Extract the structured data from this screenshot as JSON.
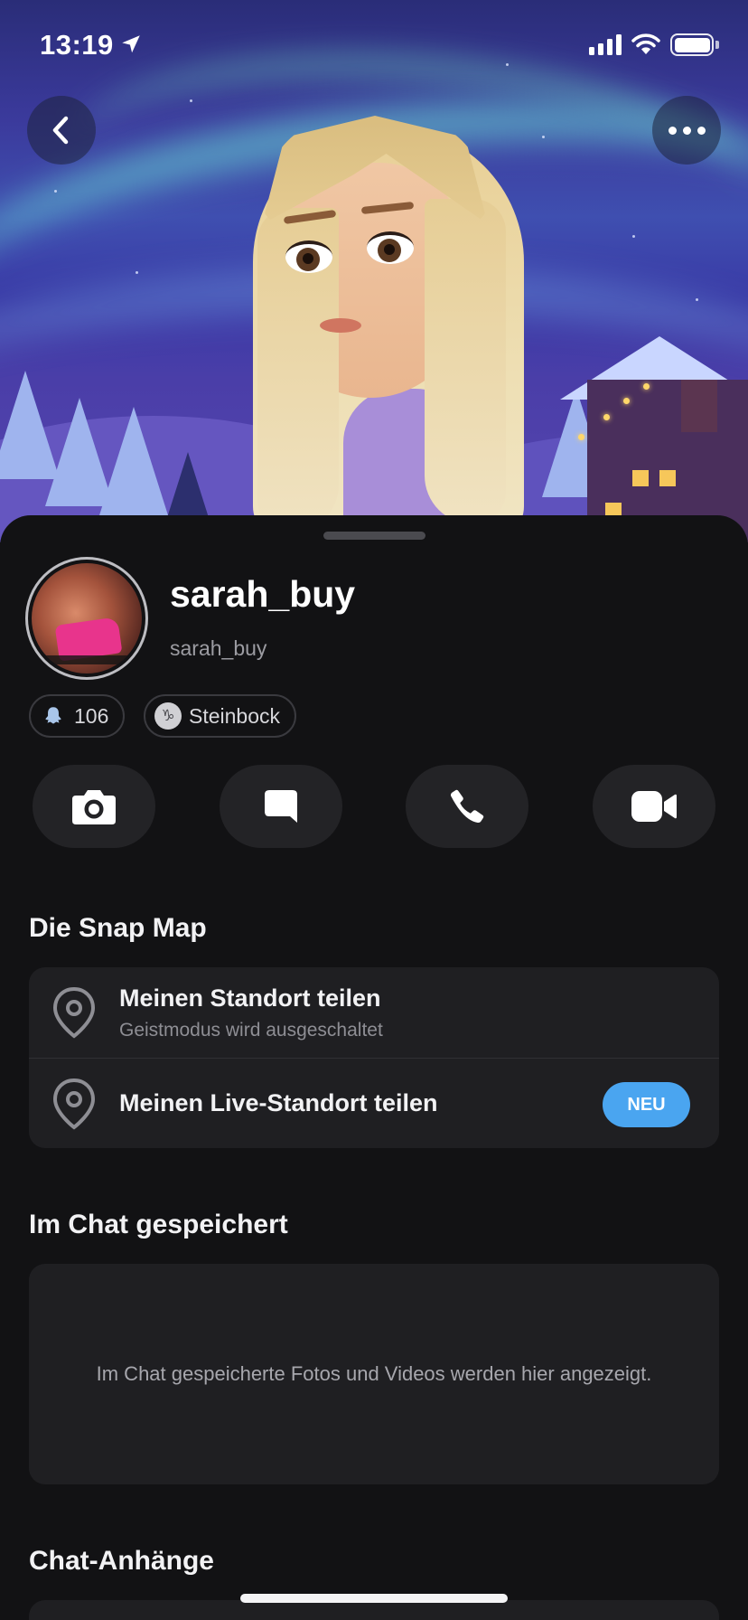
{
  "status_bar": {
    "time": "13:19",
    "location_icon": "location-arrow-icon",
    "signal_icon": "cellular-signal-icon",
    "wifi_icon": "wifi-icon",
    "battery_icon": "battery-icon"
  },
  "header": {
    "back_icon": "chevron-left-icon",
    "more_icon": "more-horizontal-icon"
  },
  "profile": {
    "display_name": "sarah_buy",
    "username": "sarah_buy",
    "snap_score": "106",
    "snap_score_icon": "ghost-icon",
    "zodiac": "Steinbock",
    "zodiac_icon": "capricorn-icon",
    "zodiac_symbol": "♑"
  },
  "actions": [
    {
      "name": "camera",
      "icon": "camera-icon"
    },
    {
      "name": "chat",
      "icon": "chat-bubble-icon"
    },
    {
      "name": "call",
      "icon": "phone-icon"
    },
    {
      "name": "video",
      "icon": "video-camera-icon"
    }
  ],
  "snap_map": {
    "title": "Die Snap Map",
    "rows": [
      {
        "title": "Meinen Standort teilen",
        "subtitle": "Geistmodus wird ausgeschaltet",
        "icon": "map-pin-icon"
      },
      {
        "title": "Meinen Live-Standort teilen",
        "badge": "NEU",
        "icon": "map-pin-icon"
      }
    ]
  },
  "saved_in_chat": {
    "title": "Im Chat gespeichert",
    "empty_text": "Im Chat gespeicherte Fotos und Videos werden hier angezeigt."
  },
  "attachments": {
    "title": "Chat-Anhänge"
  },
  "colors": {
    "background": "#121214",
    "card": "#1f1f22",
    "action_button": "#232326",
    "badge_blue": "#4aa5f0",
    "secondary_text": "#9c9ca2"
  }
}
